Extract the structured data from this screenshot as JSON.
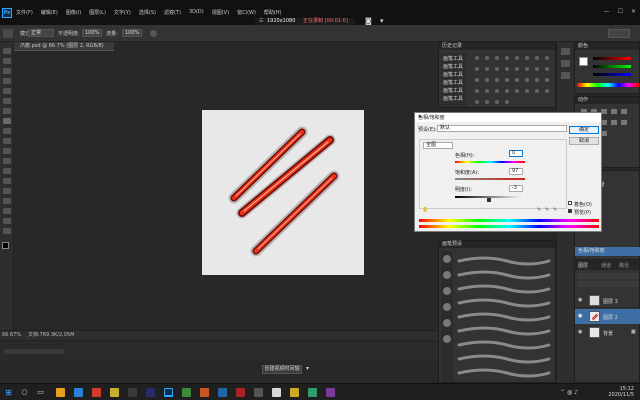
{
  "app": {
    "logo": "Ps",
    "menu": [
      "文件(F)",
      "编辑(E)",
      "图像(I)",
      "图层(L)",
      "文字(Y)",
      "选择(S)",
      "滤镜(T)",
      "3D(D)",
      "视图(V)",
      "窗口(W)",
      "帮助(H)"
    ],
    "capture_bar": {
      "size": "1920x1080",
      "status": "正在录制 [00:01:0]"
    }
  },
  "options_bar": {
    "mode_label": "模式:",
    "mode_value": "正常",
    "opacity_label": "不透明度:",
    "opacity_value": "100%",
    "flow_label": "流量:",
    "flow_value": "100%"
  },
  "document": {
    "tab_label": "爪痕.psd @ 66.7% (图层 2, RGB/8)"
  },
  "status_bar": {
    "zoom": "66.67%",
    "doc_info": "文档:769.3K/2.05M"
  },
  "timeline": {
    "create_video_label": "创建视频时间轴"
  },
  "dialog": {
    "title": "色相/饱和度",
    "preset_label": "预设(E):",
    "preset_value": "默认",
    "channel_value": "全图",
    "hue_label": "色相(H):",
    "hue_value": "0",
    "saturation_label": "饱和度(A):",
    "saturation_value": "97",
    "lightness_label": "明度(I):",
    "lightness_value": "-3",
    "ok_label": "确定",
    "cancel_label": "取消",
    "colorize_label": "着色(O)",
    "preview_label": "预览(P)"
  },
  "panels": {
    "swatch_tab": "颜色",
    "history_tab": "历史记录",
    "actions_tab": "动作",
    "brush_tab": "画笔预设",
    "layers_tab": "图层",
    "channels_tab": "通道",
    "paths_tab": "路径",
    "history_items": [
      "画笔工具",
      "画笔工具",
      "画笔工具",
      "画笔工具",
      "画笔工具",
      "画笔工具"
    ],
    "history_right_items": [
      "色相/饱和度",
      "新建图层",
      "画笔工具",
      "画笔工具",
      "色相/饱和度"
    ],
    "layers": [
      {
        "name": "图层 3"
      },
      {
        "name": "图层 2"
      },
      {
        "name": "背景"
      }
    ],
    "brush_size": "10"
  },
  "taskbar": {
    "time": "15:12",
    "date": "2020/11/5"
  },
  "colors": {
    "accent": "#31a8ff",
    "claw_red": "#d42010",
    "selection_blue": "#3d6fa5",
    "dialog_bg": "#f0f0f0"
  },
  "icons": [
    "search-icon",
    "windows-start-icon",
    "task-view-icon",
    "photoshop-icon",
    "eyedropper-icon",
    "hand-icon",
    "close-icon",
    "camera-icon",
    "lock-icon",
    "eye-icon",
    "minimize-icon",
    "maximize-icon"
  ]
}
